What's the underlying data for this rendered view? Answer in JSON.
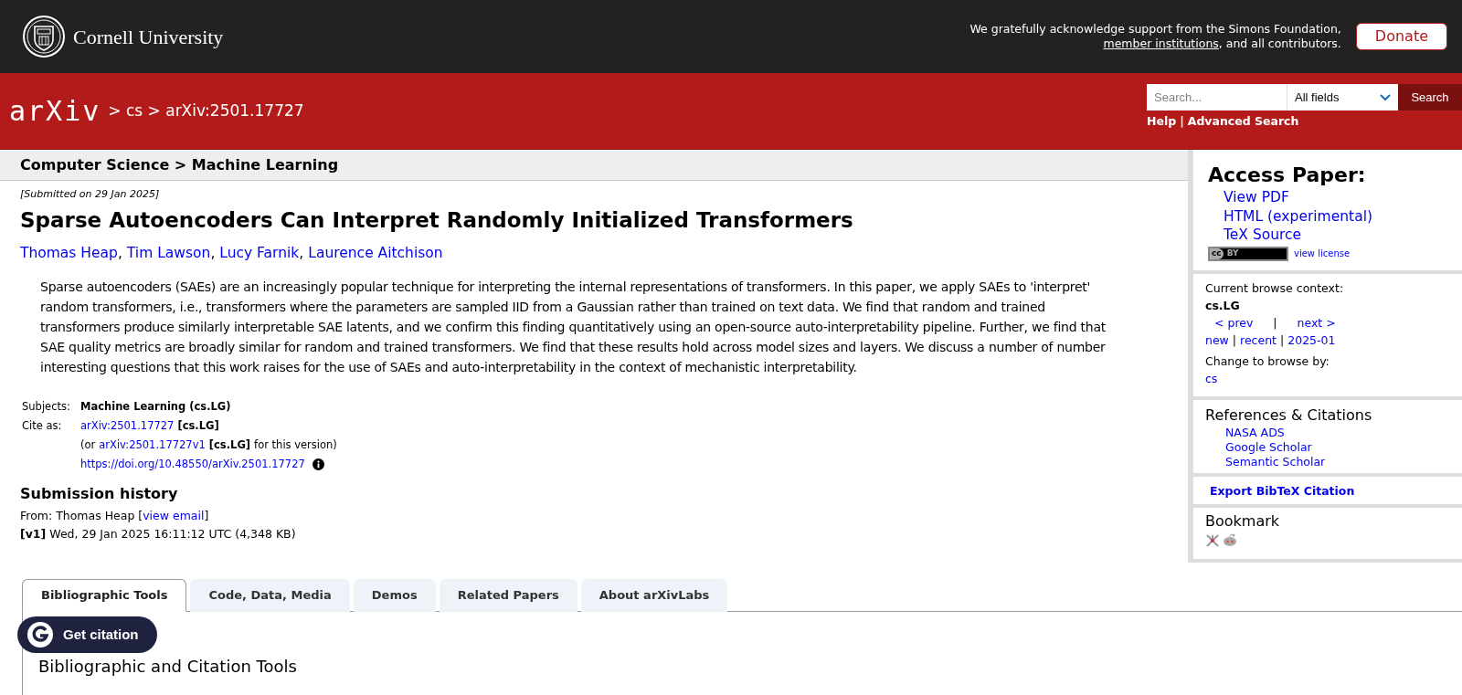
{
  "top_bar": {
    "wordmark": "Cornell University",
    "ack_before": "We gratefully acknowledge support from the Simons Foundation,",
    "ack_link": "member institutions",
    "ack_after": ", and all contributors.",
    "donate": "Donate"
  },
  "nav": {
    "logo_text": "arXiv",
    "breadcrumb": "> cs > arXiv:2501.17727",
    "search_placeholder": "Search...",
    "field_select": "All fields",
    "search_button": "Search",
    "help": "Help",
    "separator": "|",
    "advanced": "Advanced Search"
  },
  "subheader": "Computer Science > Machine Learning",
  "paper": {
    "submitted": "[Submitted on 29 Jan 2025]",
    "title": "Sparse Autoencoders Can Interpret Randomly Initialized Transformers",
    "author_separator": ",",
    "authors": [
      "Thomas Heap",
      "Tim Lawson",
      "Lucy Farnik",
      "Laurence Aitchison"
    ],
    "abstract": "Sparse autoencoders (SAEs) are an increasingly popular technique for interpreting the internal representations of transformers. In this paper, we apply SAEs to 'interpret' random transformers, i.e., transformers where the parameters are sampled IID from a Gaussian rather than trained on text data. We find that random and trained transformers produce similarly interpretable SAE latents, and we confirm this finding quantitatively using an open-source auto-interpretability pipeline. Further, we find that SAE quality metrics are broadly similar for random and trained transformers. We find that these results hold across model sizes and layers. We discuss a number of number interesting questions that this work raises for the use of SAEs and auto-interpretability in the context of mechanistic interpretability."
  },
  "metadata": {
    "subjects_label": "Subjects:",
    "subjects": "Machine Learning (cs.LG)",
    "cite_label": "Cite as:",
    "cite_id": "arXiv:2501.17727",
    "cite_cat": "[cs.LG]",
    "version_open": "(or",
    "version_id": "arXiv:2501.17727v1",
    "version_cat": "[cs.LG]",
    "version_close": "for this version)",
    "doi": "https://doi.org/10.48550/arXiv.2501.17727"
  },
  "history": {
    "heading": "Submission history",
    "from_before": "From: Thomas Heap [",
    "from_link": "view email",
    "from_after": "]",
    "version": "[v1]",
    "version_text": "Wed, 29 Jan 2025 16:11:12 UTC (4,348 KB)"
  },
  "tabs": [
    {
      "label": "Bibliographic Tools",
      "selected": true
    },
    {
      "label": "Code, Data, Media",
      "selected": false
    },
    {
      "label": "Demos",
      "selected": false
    },
    {
      "label": "Related Papers",
      "selected": false
    },
    {
      "label": "About arXivLabs",
      "selected": false
    }
  ],
  "panel_heading": "Bibliographic and Citation Tools",
  "floating_button": "Get citation",
  "sidebar": {
    "access_heading": "Access Paper:",
    "access_links": [
      "View PDF",
      "HTML (experimental)",
      "TeX Source"
    ],
    "license_badge": [
      "cc",
      "BY"
    ],
    "license_link": "view license",
    "browse_label": "Current browse context:",
    "browse_context": "cs.LG",
    "prev": "< prev",
    "pipe": "|",
    "next": "next >",
    "browse_links": [
      "new",
      "recent",
      "2025-01"
    ],
    "change_label": "Change to browse by:",
    "change_links": [
      "cs"
    ],
    "refs_heading": "References & Citations",
    "refs_links": [
      "NASA ADS",
      "Google Scholar",
      "Semantic Scholar"
    ],
    "export": "Export BibTeX Citation",
    "bookmark_heading": "Bookmark"
  }
}
